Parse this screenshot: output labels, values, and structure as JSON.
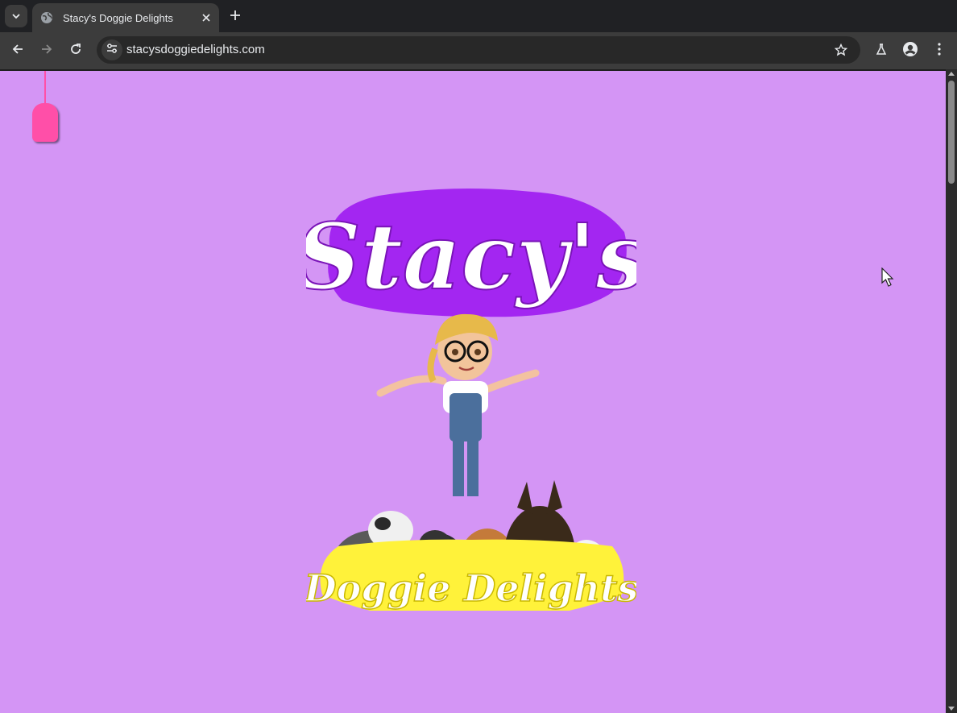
{
  "browser": {
    "tab": {
      "title": "Stacy's Doggie Delights"
    },
    "address_bar": {
      "url": "stacysdoggiedelights.com"
    }
  },
  "page": {
    "background_color": "#d495f5",
    "logo": {
      "top_text": "Stacy's",
      "bottom_text": "Doggie Delights",
      "top_color": "#a020f0",
      "bottom_color": "#fff23a"
    }
  },
  "icons": [
    "tab-search-icon",
    "globe-icon",
    "close-icon",
    "plus-icon",
    "back-arrow-icon",
    "forward-arrow-icon",
    "reload-icon",
    "tune-icon",
    "star-icon",
    "flask-icon",
    "profile-icon",
    "kebab-menu-icon",
    "mouse-cursor-icon"
  ]
}
